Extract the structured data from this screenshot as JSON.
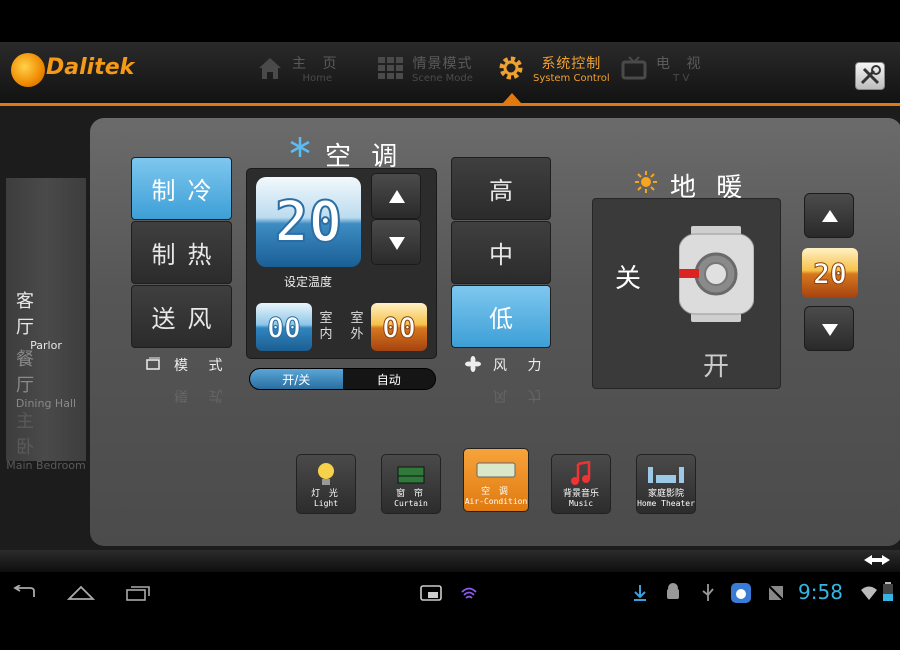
{
  "app": {
    "logo_text": "Dalitek",
    "accent_color": "#e07a10"
  },
  "nav": [
    {
      "zh": "主 页",
      "en": "Home",
      "icon": "home-icon"
    },
    {
      "zh": "情景模式",
      "en": "Scene Mode",
      "icon": "grid-icon"
    },
    {
      "zh": "系统控制",
      "en": "System Control",
      "icon": "gear-icon",
      "active": true
    },
    {
      "zh": "电 视",
      "en": "T V",
      "icon": "tv-icon"
    }
  ],
  "rooms": [
    {
      "zh": "客 厅",
      "en": "Parlor"
    },
    {
      "zh": "餐 厅",
      "en": "Dining Hall"
    },
    {
      "zh": "主 卧",
      "en": "Main Bedroom"
    }
  ],
  "ac": {
    "title": "空 调",
    "modes": [
      "制冷",
      "制热",
      "送风"
    ],
    "active_mode": "制冷",
    "mode_label": "模 式",
    "set_temp": "20",
    "set_temp_label": "设定温度",
    "indoor_temp": "00",
    "indoor_label": "室内",
    "outdoor_temp": "00",
    "outdoor_label": "室外",
    "power_label": "开/关",
    "auto_label": "自动",
    "fan_levels": [
      "高",
      "中",
      "低"
    ],
    "active_fan": "低",
    "fan_label": "风 力"
  },
  "floor_heat": {
    "title": "地 暖",
    "off_label": "关",
    "on_label": "开",
    "temp": "20"
  },
  "devices": [
    {
      "zh": "灯 光",
      "en": "Light",
      "icon": "bulb-icon"
    },
    {
      "zh": "窗 帘",
      "en": "Curtain",
      "icon": "curtain-icon"
    },
    {
      "zh": "空 调",
      "en": "Air-Condition",
      "icon": "aircon-icon",
      "active": true
    },
    {
      "zh": "背景音乐",
      "en": "Music",
      "icon": "music-icon"
    },
    {
      "zh": "家庭影院",
      "en": "Home Theater",
      "icon": "theater-icon"
    }
  ],
  "status_bar": {
    "clock": "9:58"
  }
}
